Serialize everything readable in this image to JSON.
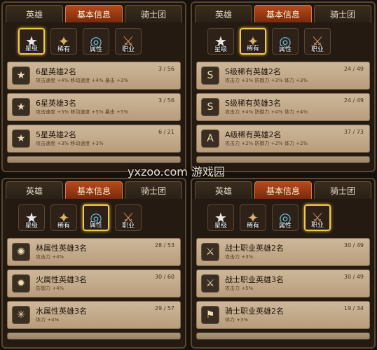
{
  "tabs": [
    "英雄",
    "基本信息",
    "骑士团"
  ],
  "categories": [
    {
      "label": "星级",
      "icon": "star-icon"
    },
    {
      "label": "稀有",
      "icon": "rare-shield-icon"
    },
    {
      "label": "属性",
      "icon": "attribute-ring-icon"
    },
    {
      "label": "职业",
      "icon": "class-figure-icon"
    }
  ],
  "panels": [
    {
      "active_tab": 1,
      "active_category": 0,
      "rows": [
        {
          "icon": "star-6-icon",
          "glyph": "★",
          "title": "6星英雄2名",
          "count": "3 / 56",
          "desc": "攻击速度 +4% 移动速度 +4% 暴击 +3%"
        },
        {
          "icon": "star-6-icon",
          "glyph": "★",
          "title": "6星英雄3名",
          "count": "3 / 56",
          "desc": "攻击速度 +5% 移动速度 +5% 暴击 +5%"
        },
        {
          "icon": "star-5-icon",
          "glyph": "★",
          "title": "5星英雄2名",
          "count": "6 / 21",
          "desc": "攻击速度 +3% 移动速度 +3%"
        }
      ]
    },
    {
      "active_tab": 1,
      "active_category": 1,
      "rows": [
        {
          "icon": "rank-s-icon",
          "glyph": "S",
          "title": "S级稀有英雄2名",
          "count": "24 / 49",
          "desc": "攻击力 +3% 防御力 +3% 体力 +3%"
        },
        {
          "icon": "rank-s-icon",
          "glyph": "S",
          "title": "S级稀有英雄3名",
          "count": "24 / 49",
          "desc": "攻击力 +4% 防御力 +4% 体力 +4%"
        },
        {
          "icon": "rank-a-icon",
          "glyph": "A",
          "title": "A级稀有英雄2名",
          "count": "37 / 73",
          "desc": "攻击力 +2% 防御力 +2% 体力 +2%"
        }
      ]
    },
    {
      "active_tab": 1,
      "active_category": 2,
      "rows": [
        {
          "icon": "wind-attribute-icon",
          "glyph": "✺",
          "title": "林属性英雄3名",
          "count": "28 / 53",
          "desc": "攻击力 +4%"
        },
        {
          "icon": "fire-attribute-icon",
          "glyph": "✹",
          "title": "火属性英雄3名",
          "count": "30 / 60",
          "desc": "防御力 +4%"
        },
        {
          "icon": "water-attribute-icon",
          "glyph": "✳",
          "title": "水属性英雄3名",
          "count": "29 / 57",
          "desc": "体力 +4%"
        }
      ]
    },
    {
      "active_tab": 1,
      "active_category": 3,
      "rows": [
        {
          "icon": "sword-icon",
          "glyph": "⚔",
          "title": "战士职业英雄2名",
          "count": "30 / 49",
          "desc": "攻击力 +3%"
        },
        {
          "icon": "sword-icon",
          "glyph": "⚔",
          "title": "战士职业英雄3名",
          "count": "30 / 49",
          "desc": "攻击力 +5%"
        },
        {
          "icon": "knight-icon",
          "glyph": "⚑",
          "title": "骑士职业英雄2名",
          "count": "19 / 34",
          "desc": "体力 +3%"
        }
      ]
    }
  ],
  "watermark": "yxzoo.com 游戏园",
  "colors": {
    "active_tab": "#b64a1a",
    "highlight": "#f2c84a",
    "row_bg": "#cdb79a"
  }
}
